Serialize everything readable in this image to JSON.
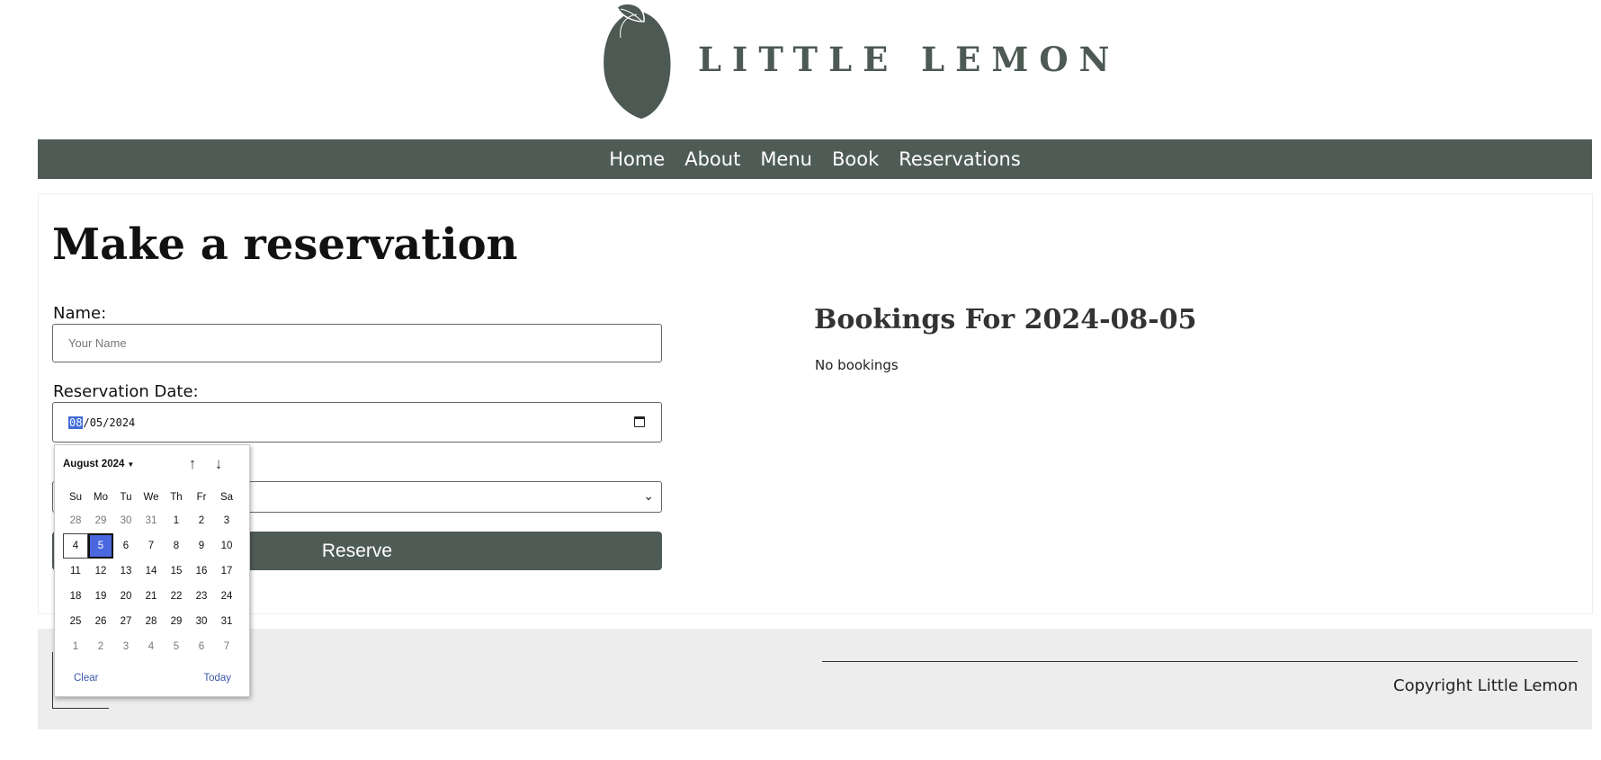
{
  "brand": {
    "name": "LITTLE LEMON"
  },
  "nav": [
    {
      "label": "Home"
    },
    {
      "label": "About"
    },
    {
      "label": "Menu"
    },
    {
      "label": "Book"
    },
    {
      "label": "Reservations"
    }
  ],
  "form": {
    "heading": "Make a reservation",
    "name_label": "Name:",
    "name_placeholder": "Your Name",
    "name_value": "",
    "date_label": "Reservation Date:",
    "date_month": "08",
    "date_day": "05",
    "date_year": "2024",
    "reserve_label": "Reserve"
  },
  "bookings": {
    "title": "Bookings For 2024-08-05",
    "empty_text": "No bookings"
  },
  "datepicker": {
    "month_label": "August 2024",
    "weekdays": [
      "Su",
      "Mo",
      "Tu",
      "We",
      "Th",
      "Fr",
      "Sa"
    ],
    "weeks": [
      [
        "28",
        "29",
        "30",
        "31",
        "1",
        "2",
        "3"
      ],
      [
        "4",
        "5",
        "6",
        "7",
        "8",
        "9",
        "10"
      ],
      [
        "11",
        "12",
        "13",
        "14",
        "15",
        "16",
        "17"
      ],
      [
        "18",
        "19",
        "20",
        "21",
        "22",
        "23",
        "24"
      ],
      [
        "25",
        "26",
        "27",
        "28",
        "29",
        "30",
        "31"
      ],
      [
        "1",
        "2",
        "3",
        "4",
        "5",
        "6",
        "7"
      ]
    ],
    "today_day": "4",
    "selected_day": "5",
    "clear_label": "Clear",
    "today_label": "Today",
    "prev_icon": "arrow-up-icon",
    "next_icon": "arrow-down-icon"
  },
  "footer": {
    "copyright": "Copyright Little Lemon"
  },
  "colors": {
    "brand_green": "#4f5c56",
    "footer_bg": "#ededed",
    "accent_blue": "#4a67e0"
  }
}
